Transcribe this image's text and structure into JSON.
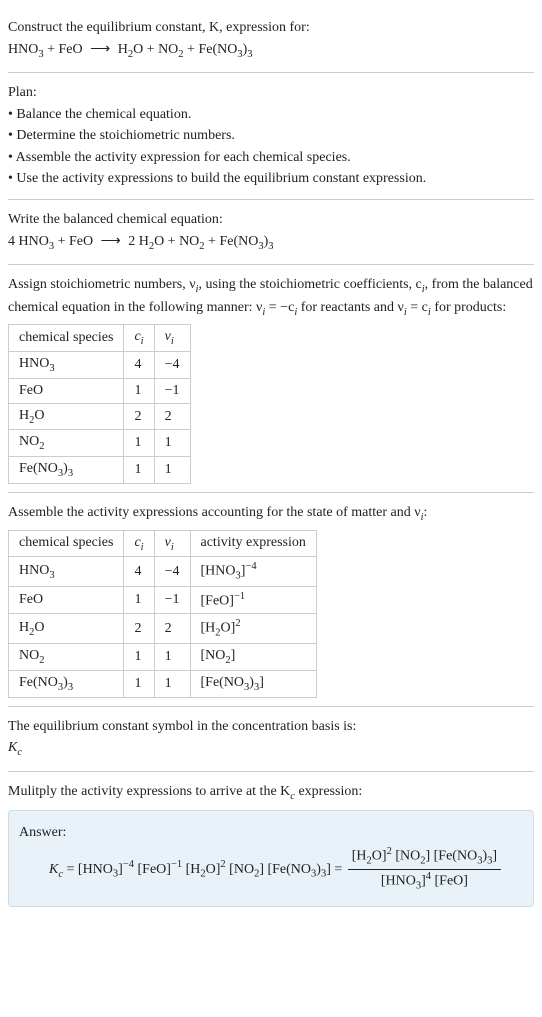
{
  "intro": {
    "line1": "Construct the equilibrium constant, K, expression for:",
    "reaction_lhs": "HNO",
    "reaction_plus1": " + FeO ",
    "reaction_arrow": "⟶",
    "reaction_rhs1": " H",
    "reaction_rhs2": "O + NO",
    "reaction_rhs3": " + Fe(NO",
    "reaction_rhs4": ")"
  },
  "plan": {
    "heading": "Plan:",
    "b1": "• Balance the chemical equation.",
    "b2": "• Determine the stoichiometric numbers.",
    "b3": "• Assemble the activity expression for each chemical species.",
    "b4": "• Use the activity expressions to build the equilibrium constant expression."
  },
  "balanced": {
    "heading": "Write the balanced chemical equation:",
    "c1": "4 HNO",
    "c2": " + FeO ",
    "arrow": "⟶",
    "c3": " 2 H",
    "c4": "O + NO",
    "c5": " + Fe(NO",
    "c6": ")"
  },
  "stoich": {
    "text1": "Assign stoichiometric numbers, ν",
    "text2": ", using the stoichiometric coefficients, c",
    "text3": ", from the balanced chemical equation in the following manner: ν",
    "text4": " = −c",
    "text5": " for reactants and ν",
    "text6": " = c",
    "text7": " for products:",
    "h1": "chemical species",
    "h2": "c",
    "h3": "ν",
    "rows": [
      {
        "sp": "HNO",
        "sub": "3",
        "c": "4",
        "v": "−4"
      },
      {
        "sp": "FeO",
        "sub": "",
        "c": "1",
        "v": "−1"
      },
      {
        "sp": "H",
        "sub": "2",
        "tail": "O",
        "c": "2",
        "v": "2"
      },
      {
        "sp": "NO",
        "sub": "2",
        "c": "1",
        "v": "1"
      },
      {
        "sp": "Fe(NO",
        "sub": "3",
        "tail": ")",
        "tailsub": "3",
        "c": "1",
        "v": "1"
      }
    ]
  },
  "activity": {
    "heading": "Assemble the activity expressions accounting for the state of matter and ν",
    "heading_tail": ":",
    "h1": "chemical species",
    "h2": "c",
    "h3": "ν",
    "h4": "activity expression",
    "r0c": "4",
    "r0v": "−4",
    "r1c": "1",
    "r1v": "−1",
    "r2c": "2",
    "r2v": "2",
    "r3c": "1",
    "r3v": "1",
    "r4c": "1",
    "r4v": "1"
  },
  "symbol": {
    "line1": "The equilibrium constant symbol in the concentration basis is:",
    "kc": "K"
  },
  "final": {
    "heading": "Mulitply the activity expressions to arrive at the K",
    "heading2": " expression:",
    "answer_label": "Answer:"
  },
  "chart_data": {
    "type": "table",
    "title": "Stoichiometric numbers and activity expressions",
    "tables": [
      {
        "columns": [
          "chemical species",
          "c_i",
          "ν_i"
        ],
        "rows": [
          [
            "HNO3",
            4,
            -4
          ],
          [
            "FeO",
            1,
            -1
          ],
          [
            "H2O",
            2,
            2
          ],
          [
            "NO2",
            1,
            1
          ],
          [
            "Fe(NO3)3",
            1,
            1
          ]
        ]
      },
      {
        "columns": [
          "chemical species",
          "c_i",
          "ν_i",
          "activity expression"
        ],
        "rows": [
          [
            "HNO3",
            4,
            -4,
            "[HNO3]^-4"
          ],
          [
            "FeO",
            1,
            -1,
            "[FeO]^-1"
          ],
          [
            "H2O",
            2,
            2,
            "[H2O]^2"
          ],
          [
            "NO2",
            1,
            1,
            "[NO2]"
          ],
          [
            "Fe(NO3)3",
            1,
            1,
            "[Fe(NO3)3]"
          ]
        ]
      }
    ],
    "balanced_equation": "4 HNO3 + FeO ⟶ 2 H2O + NO2 + Fe(NO3)3",
    "Kc_expression": "Kc = [HNO3]^-4 [FeO]^-1 [H2O]^2 [NO2] [Fe(NO3)3] = ([H2O]^2 [NO2] [Fe(NO3)3]) / ([HNO3]^4 [FeO])"
  }
}
